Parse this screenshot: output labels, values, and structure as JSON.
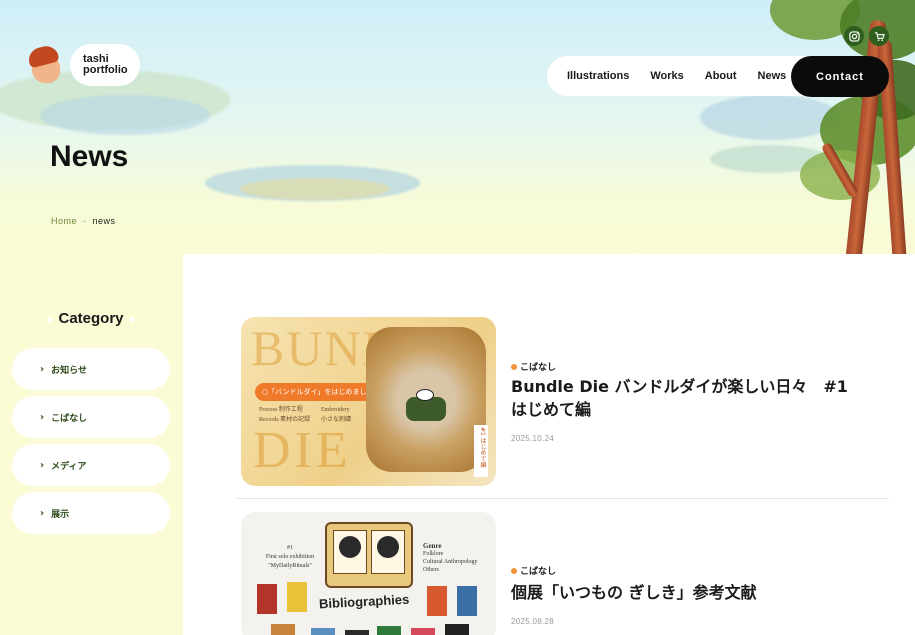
{
  "logo": {
    "line1": "tashi",
    "line2": "portfolio"
  },
  "nav": {
    "items": [
      "Illustrations",
      "Works",
      "About",
      "News"
    ],
    "contact_label": "Contact"
  },
  "social": {
    "icons": [
      "instagram-icon",
      "cart-icon"
    ]
  },
  "hero": {
    "title": "News",
    "breadcrumb": {
      "home": "Home",
      "separator": "-",
      "current": "news"
    }
  },
  "sidebar": {
    "title": "Category",
    "items": [
      {
        "label": "お知らせ"
      },
      {
        "label": "こばなし"
      },
      {
        "label": "メディア"
      },
      {
        "label": "展示"
      }
    ]
  },
  "posts": [
    {
      "category": "こばなし",
      "title": "Bundle Die バンドルダイが楽しい日々　#1 はじめて編",
      "date": "2025.10.24",
      "thumb": {
        "word_top": "BUNDLE",
        "word_bottom": "DIE",
        "badge": "○「バンドルダイ」をはじめました○",
        "line1_a": "Process",
        "line1_b": "制作工程",
        "line2_a": "Records",
        "line2_b": "素材の記録",
        "col2_a": "Embroidery",
        "col2_b": "小さな刺繍",
        "side": "#1 はじめて編"
      }
    },
    {
      "category": "こばなし",
      "title": "個展「いつもの ぎしき」参考文献",
      "date": "2025.08.28",
      "thumb": {
        "heading": "Bibliographies",
        "left_a": "#1",
        "left_b": "First solo exhibition",
        "left_c": "\"MyDailyRituals\"",
        "right_a": "Genre",
        "right_b": "Folklore",
        "right_c": "Cultural Anthropology",
        "right_d": "Others"
      }
    }
  ],
  "colors": {
    "accent_green": "#2f5f1e",
    "tag_dot": "#f0933a",
    "sidebar_bg": "#fbfbd6",
    "contact_bg": "#0b0b0b"
  }
}
